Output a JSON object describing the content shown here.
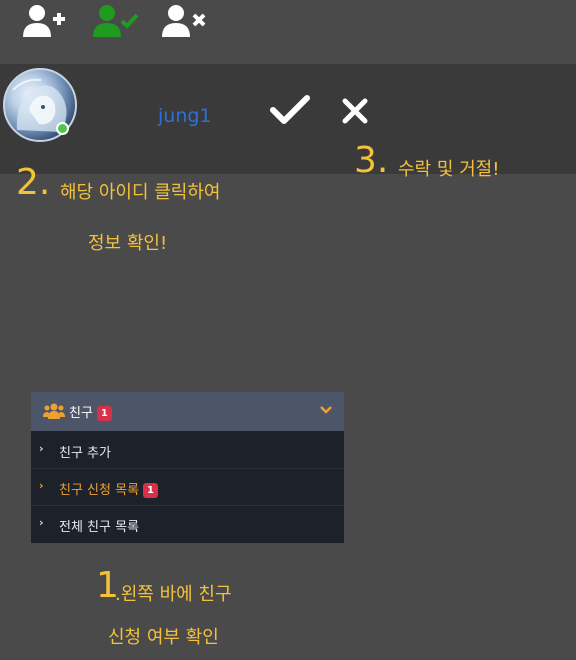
{
  "top_bar": {
    "add_friend_icon": "user-plus-icon",
    "friend_confirm_icon": "user-check-icon",
    "remove_friend_icon": "user-times-icon",
    "icon_color_default": "#ffffff",
    "icon_color_active": "#1f9b1f"
  },
  "friend_request": {
    "username": "jung1",
    "accept_icon": "check-icon",
    "reject_icon": "close-icon",
    "status": "online"
  },
  "annotations": {
    "step2_number": "2.",
    "step2_line1": "해당 아이디 클릭하여",
    "step2_line2": "정보 확인!",
    "step3_number": "3.",
    "step3_text": "수락 및 거절!",
    "step1_number": "1",
    "step1_line1": ".왼쪽 바에 친구",
    "step1_line2": "신청 여부 확인"
  },
  "sidebar_menu": {
    "header_label": "친구",
    "header_badge": "1",
    "items": [
      {
        "label": "친구 추가",
        "badge": ""
      },
      {
        "label": "친구 신청 목록",
        "badge": "1"
      },
      {
        "label": "전체 친구 목록",
        "badge": ""
      }
    ]
  },
  "colors": {
    "annotation": "#f3c23a",
    "username": "#2f6fd6",
    "badge": "#d9304a",
    "menu_active": "#f0a030"
  }
}
